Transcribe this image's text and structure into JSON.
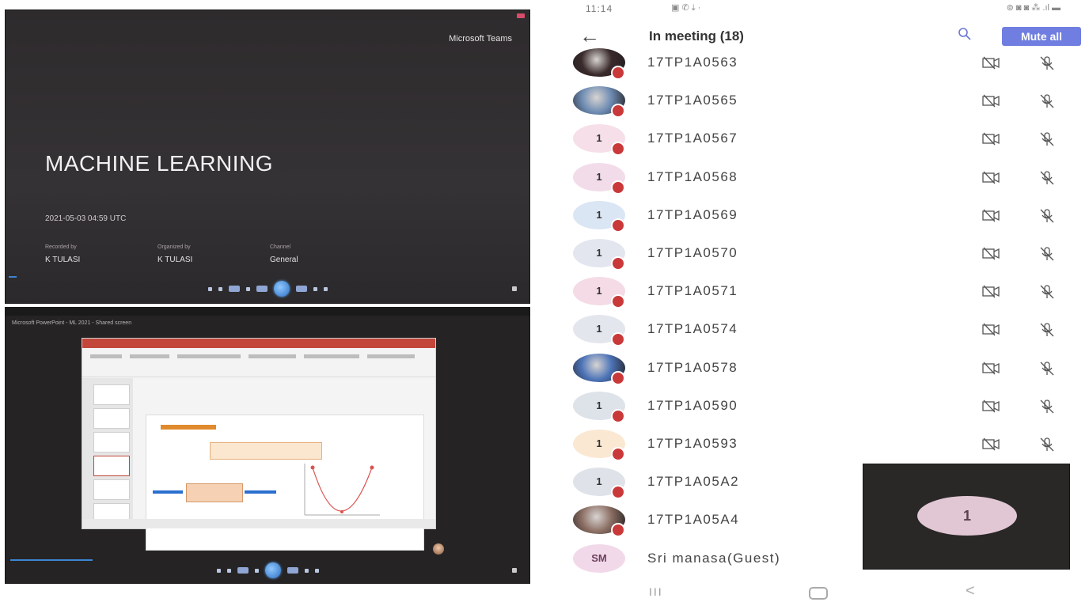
{
  "top_video": {
    "brand": "Microsoft Teams",
    "slide_title": "MACHINE LEARNING",
    "slide_date": "2021-05-03 04:59 UTC",
    "meta_labels": [
      "Recorded by",
      "Organized by",
      "Channel"
    ],
    "meta_values": [
      "K TULASI",
      "K TULASI",
      "General"
    ]
  },
  "bottom_video": {
    "window_caption": "Microsoft PowerPoint - ML 2021 - Shared screen"
  },
  "phone": {
    "status_time": "11:14",
    "status_icons": "▣ ✆ ⤓ ·",
    "status_right": "⊚ ◙ ◙ ⁂ .ıl ▬",
    "header_title": "In meeting (18)",
    "back_icon": "arrow-left-icon",
    "search_icon": "search-icon",
    "mute_all_label": "Mute all",
    "participants": [
      {
        "name": "17TP1A0563",
        "initial": "",
        "avatar_color": "#3a2a2c",
        "photo": true
      },
      {
        "name": "17TP1A0565",
        "initial": "",
        "avatar_color": "#6d8bb2",
        "photo": true
      },
      {
        "name": "17TP1A0567",
        "initial": "1",
        "avatar_color": "#f6dfe8",
        "photo": false
      },
      {
        "name": "17TP1A0568",
        "initial": "1",
        "avatar_color": "#f3dcea",
        "photo": false
      },
      {
        "name": "17TP1A0569",
        "initial": "1",
        "avatar_color": "#dbe6f4",
        "photo": false
      },
      {
        "name": "17TP1A0570",
        "initial": "1",
        "avatar_color": "#e3e6ef",
        "photo": false
      },
      {
        "name": "17TP1A0571",
        "initial": "1",
        "avatar_color": "#f5dbe6",
        "photo": false
      },
      {
        "name": "17TP1A0574",
        "initial": "1",
        "avatar_color": "#e4e6ee",
        "photo": false
      },
      {
        "name": "17TP1A0578",
        "initial": "",
        "avatar_color": "#4d74b8",
        "photo": true
      },
      {
        "name": "17TP1A0590",
        "initial": "1",
        "avatar_color": "#dee3ea",
        "photo": false
      },
      {
        "name": "17TP1A0593",
        "initial": "1",
        "avatar_color": "#fbe8d3",
        "photo": false
      },
      {
        "name": "17TP1A05A2",
        "initial": "1",
        "avatar_color": "#dfe3e9",
        "photo": false
      },
      {
        "name": "17TP1A05A4",
        "initial": "",
        "avatar_color": "#8b6e63",
        "photo": true
      },
      {
        "name": "Sri manasa(Guest)",
        "initial": "SM",
        "avatar_color": "#f2d9ea",
        "photo": false
      }
    ],
    "mini_video_initial": "1",
    "nav": {
      "recents": "III",
      "back": "<"
    }
  },
  "colors": {
    "accent": "#6f7ee0",
    "presence_busy": "#c9393a",
    "video_bg": "#2e2b2d"
  }
}
